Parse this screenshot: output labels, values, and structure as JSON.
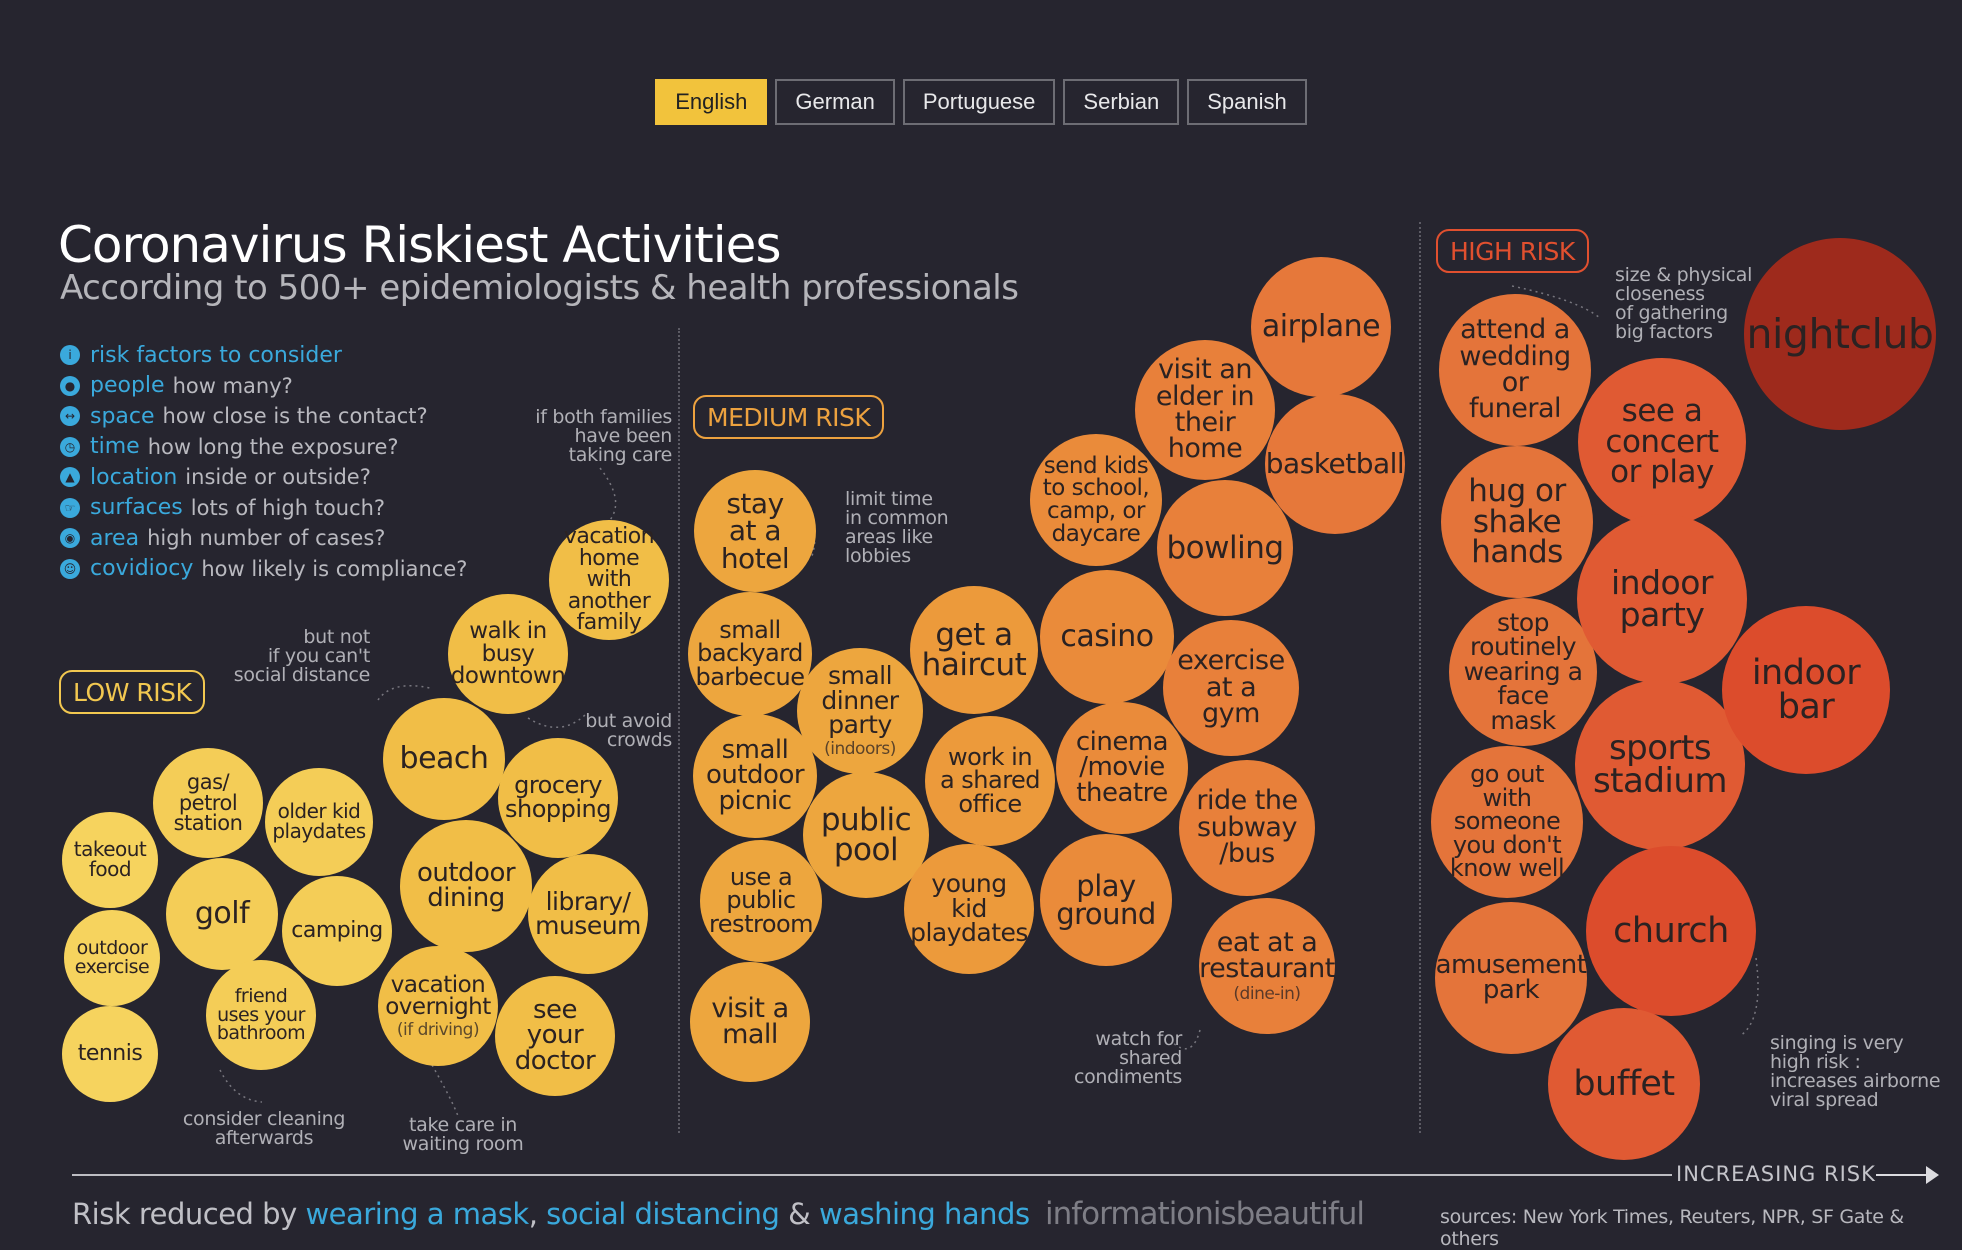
{
  "tabs": [
    "English",
    "German",
    "Portuguese",
    "Serbian",
    "Spanish"
  ],
  "title": "Coronavirus Riskiest Activities",
  "subtitle": "According to 500+ epidemiologists & health professionals",
  "risk_factors": {
    "heading": "risk factors to consider",
    "items": [
      {
        "key": "people",
        "text": "how many?",
        "icon": "people-icon"
      },
      {
        "key": "space",
        "text": "how close is the contact?",
        "icon": "space-icon"
      },
      {
        "key": "time",
        "text": "how long the exposure?",
        "icon": "clock-icon"
      },
      {
        "key": "location",
        "text": "inside or outside?",
        "icon": "location-icon"
      },
      {
        "key": "surfaces",
        "text": "lots of high touch?",
        "icon": "hand-icon"
      },
      {
        "key": "area",
        "text": "high number of cases?",
        "icon": "globe-icon"
      },
      {
        "key": "covidiocy",
        "text": "how likely is compliance?",
        "icon": "head-icon"
      }
    ]
  },
  "zones": {
    "low": "LOW RISK",
    "medium": "MEDIUM RISK",
    "high": "HIGH RISK"
  },
  "bubbles": {
    "takeout": "takeout food",
    "outdoor_exercise": "outdoor exercise",
    "tennis": "tennis",
    "gas": "gas/ petrol station",
    "golf": "golf",
    "friend": "friend uses your bathroom",
    "older_kid": "older kid playdates",
    "camping": "camping",
    "beach": "beach",
    "outdoor_dining": "outdoor dining",
    "vacation_overnight": "vacation overnight",
    "vacation_overnight_sub": "(if driving)",
    "walk": "walk in busy downtown",
    "grocery": "grocery shopping",
    "library": "library/ museum",
    "doctor": "see your doctor",
    "vacation_home": "vacation home with another family",
    "hotel": "stay at a hotel",
    "barbecue": "small backyard barbecue",
    "picnic": "small outdoor picnic",
    "restroom": "use a public restroom",
    "mall": "visit a mall",
    "dinner": "small dinner party",
    "dinner_sub": "(indoors)",
    "pool": "public pool",
    "haircut": "get a haircut",
    "office": "work in a shared office",
    "young_kid": "young kid playdates",
    "casino": "casino",
    "cinema": "cinema /movie theatre",
    "playground": "play ground",
    "school": "send kids to school, camp, or daycare",
    "bowling": "bowling",
    "gym": "exercise at a gym",
    "subway": "ride the subway /bus",
    "restaurant": "eat at a restaurant",
    "restaurant_sub": "(dine-in)",
    "elder": "visit an elder in their home",
    "airplane": "airplane",
    "basketball": "basketball",
    "wedding": "attend a wedding or funeral",
    "hug": "hug or shake hands",
    "mask": "stop routinely wearing a face mask",
    "go_out": "go out with someone you don't know well",
    "amusement": "amusement park",
    "concert": "see a concert or play",
    "indoor_party": "indoor party",
    "stadium": "sports stadium",
    "church": "church",
    "buffet": "buffet",
    "nightclub": "nightclub",
    "indoor_bar": "indoor bar"
  },
  "notes": {
    "families": "if both families\nhave been\ntaking care",
    "not_distance": "but not\nif you can't\nsocial distance",
    "avoid_crowds": "but avoid\ncrowds",
    "cleaning": "consider cleaning\nafterwards",
    "waiting": "take care in\nwaiting room",
    "limit_time": "limit time\nin common\nareas like\nlobbies",
    "condiments": "watch for\nshared\ncondiments",
    "gathering": "size & physical\ncloseness\nof gathering\nbig factors",
    "singing": "singing is very\nhigh risk :\nincreases airborne\nviral spread"
  },
  "axis_label": "INCREASING RISK",
  "footer": {
    "prefix": "Risk reduced by ",
    "mask": "wearing a mask",
    "sep1": ", ",
    "distancing": "social distancing",
    "sep2": " & ",
    "hands": "washing hands"
  },
  "brand": "informationisbeautiful",
  "sources": "sources: New York Times, Reuters, NPR, SF Gate & others",
  "colors": {
    "accent_blue": "#3aa9dc",
    "low": "#f2c850",
    "medium": "#eda23f",
    "high": "#e1502f",
    "nightclub": "#9e2a1c",
    "active_tab": "#f2c33c"
  }
}
